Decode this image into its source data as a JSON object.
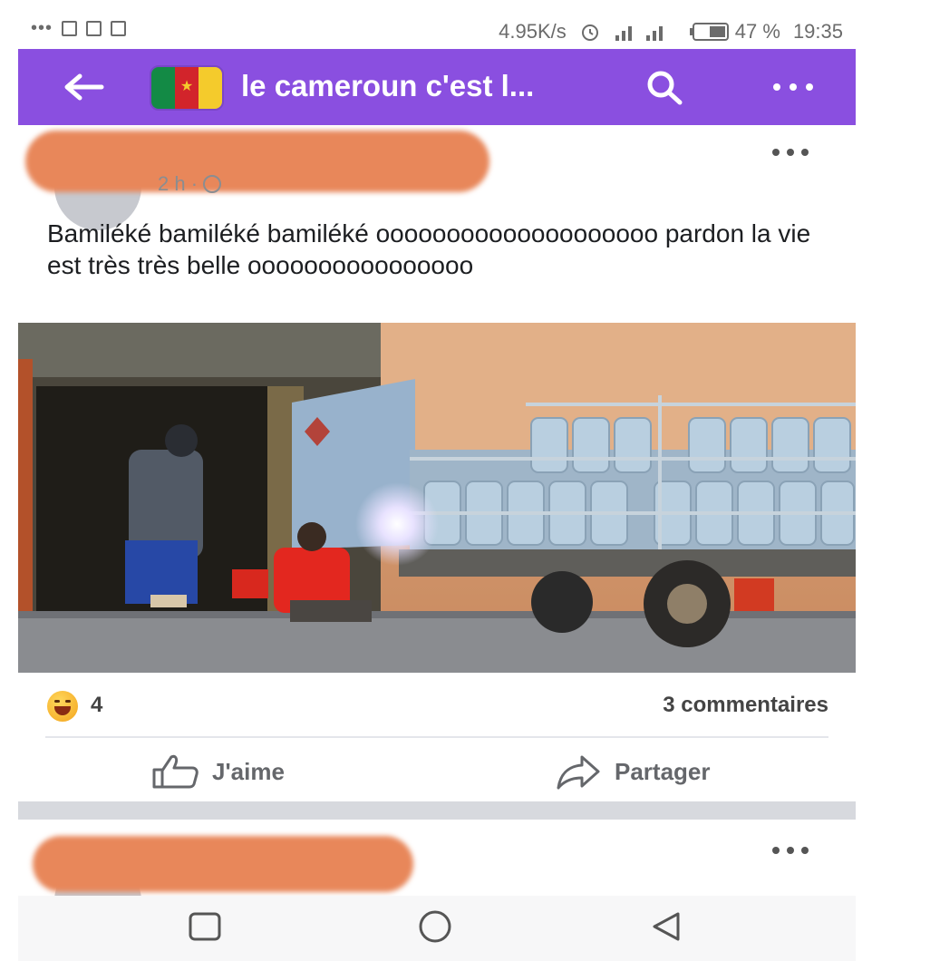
{
  "status_bar": {
    "left_icons": [
      "more-icon",
      "sim-icon",
      "screenshot-icon",
      "gallery-icon"
    ],
    "net_speed": "4.95K/s",
    "battery": "47 %",
    "time": "19:35"
  },
  "app_bar": {
    "title": "le cameroun c'est l...",
    "flag_colors": [
      "#138a45",
      "#d2242b",
      "#f4cb2c"
    ],
    "accent": "#8a4fe0"
  },
  "post": {
    "time": "2 h ·",
    "text": "Bamiléké bamiléké bamiléké oooooooooooooooooooo pardon la vie est très très belle oooooooooooooooo",
    "reaction_count": "4",
    "comments": "3 commentaires",
    "like_label": "J'aime",
    "share_label": "Partager"
  },
  "colors": {
    "redaction": "#e8875a",
    "separator": "#d7d9de"
  }
}
